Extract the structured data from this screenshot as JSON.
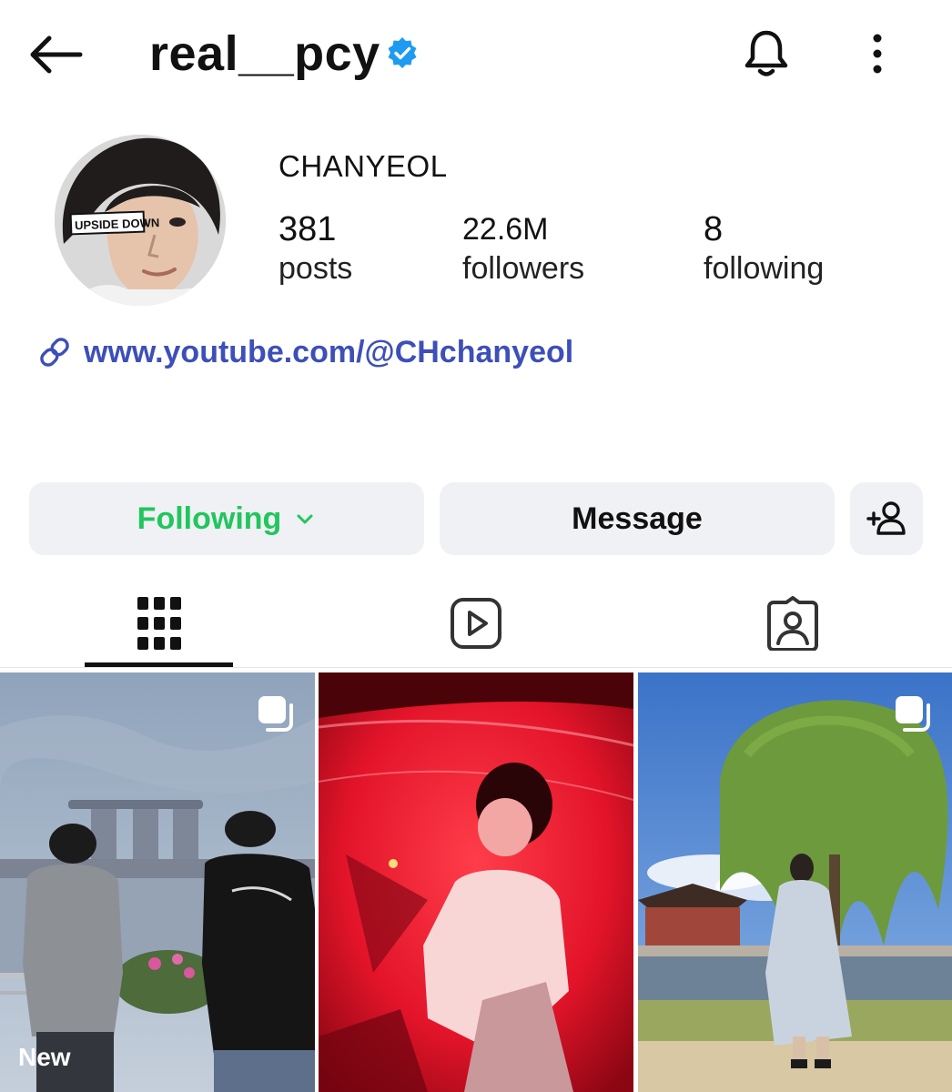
{
  "header": {
    "username": "real__pcy",
    "back_icon": "arrow-left-icon",
    "verified_icon": "verified-badge-icon",
    "bell_icon": "bell-icon",
    "more_icon": "vertical-ellipsis-icon"
  },
  "profile": {
    "display_name": "CHANYEOL",
    "avatar_text": "UPSIDE DOWN",
    "stats": {
      "posts": {
        "value": "381",
        "label": "posts"
      },
      "followers": {
        "value": "22.6M",
        "label": "followers"
      },
      "following": {
        "value": "8",
        "label": "following"
      }
    },
    "link": {
      "icon": "link-icon",
      "text": "www.youtube.com/@CHchanyeol"
    }
  },
  "actions": {
    "following_label": "Following",
    "message_label": "Message",
    "add_user_icon": "add-person-icon"
  },
  "tabs": [
    {
      "name": "posts",
      "icon": "grid-icon",
      "active": true
    },
    {
      "name": "reels",
      "icon": "reels-play-icon",
      "active": false
    },
    {
      "name": "tagged",
      "icon": "tagged-person-icon",
      "active": false
    }
  ],
  "grid": {
    "posts": [
      {
        "badge": "New",
        "multi": true
      },
      {
        "badge": "",
        "multi": false
      },
      {
        "badge": "",
        "multi": true
      }
    ]
  },
  "colors": {
    "accent_green": "#22c55e",
    "link_blue": "#3d4fb8",
    "verified_blue": "#1e9bf0",
    "button_bg": "#eff1f4"
  }
}
